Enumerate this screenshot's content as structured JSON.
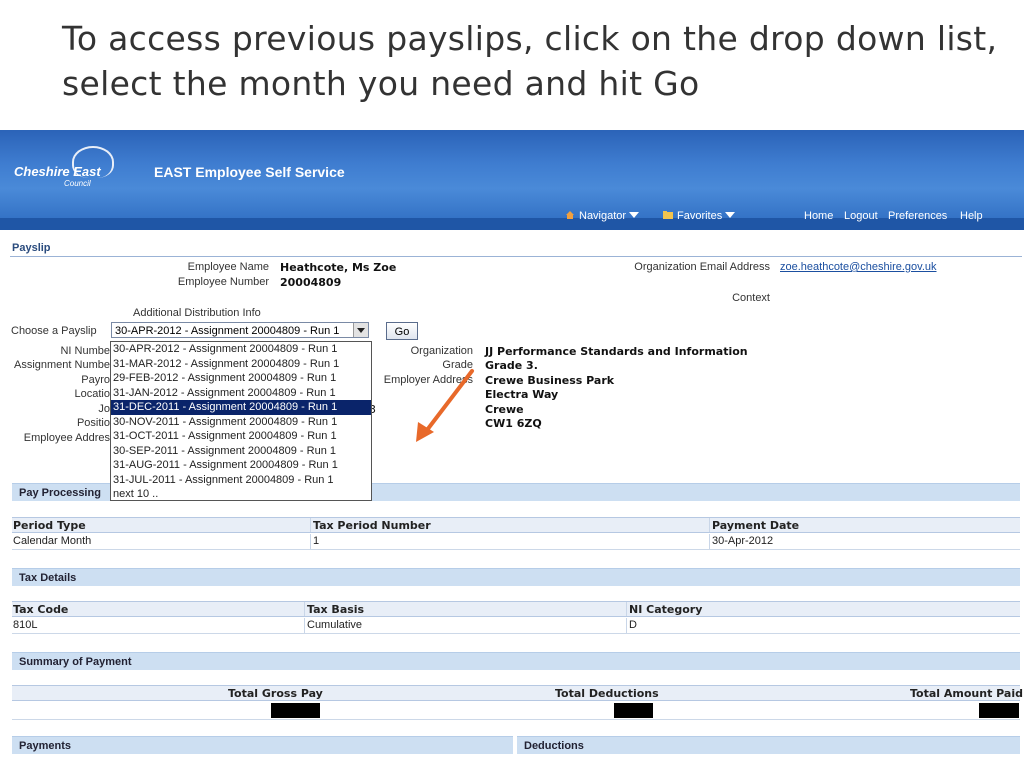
{
  "slide": {
    "title": "To access previous payslips, click on the drop down list, select the month you need and hit Go"
  },
  "header": {
    "logo_text": "Cheshire East",
    "logo_sub": "Council",
    "app_title": "EAST Employee Self Service",
    "navigator": "Navigator",
    "favorites": "Favorites",
    "links": [
      "Home",
      "Logout",
      "Preferences",
      "Help"
    ]
  },
  "payslip": {
    "section_title": "Payslip",
    "employee_name_label": "Employee Name",
    "employee_name": "Heathcote, Ms Zoe",
    "employee_number_label": "Employee Number",
    "employee_number": "20004809",
    "org_email_label": "Organization Email Address",
    "org_email": "zoe.heathcote@cheshire.gov.uk",
    "context_label": "Context",
    "additional_info_label": "Additional Distribution Info",
    "choose_label": "Choose a Payslip",
    "selected_payslip": "30-APR-2012 - Assignment 20004809 - Run 1",
    "go_label": "Go",
    "left_labels": [
      "NI Numbe",
      "Assignment Numbe",
      "Payro",
      "Locatio",
      "Jo",
      "Positio",
      "Employee Addres"
    ],
    "job_suffix": "3",
    "organization_label": "Organization",
    "organization": "JJ Performance Standards and Information",
    "grade_label": "Grade",
    "grade": "Grade 3.",
    "employer_address_label": "Employer Address",
    "employer_address": [
      "Crewe Business Park",
      "Electra Way",
      "Crewe",
      "CW1 6ZQ"
    ]
  },
  "dropdown": {
    "items": [
      "30-APR-2012 - Assignment 20004809 - Run 1",
      "31-MAR-2012 - Assignment 20004809 - Run 1",
      "29-FEB-2012 - Assignment 20004809 - Run 1",
      "31-JAN-2012 - Assignment 20004809 - Run 1",
      "31-DEC-2011 - Assignment 20004809 - Run 1",
      "30-NOV-2011 - Assignment 20004809 - Run 1",
      "31-OCT-2011 - Assignment 20004809 - Run 1",
      "30-SEP-2011 - Assignment 20004809 - Run 1",
      "31-AUG-2011 - Assignment 20004809 - Run 1",
      "31-JUL-2011 - Assignment 20004809 - Run 1",
      "next 10 .."
    ],
    "highlighted": "31-DEC-2011 - Assignment 20004809 - Run 1"
  },
  "pay_processing": {
    "title": "Pay Processing",
    "headers": [
      "Period Type",
      "Tax Period Number",
      "Payment Date"
    ],
    "row": [
      "Calendar Month",
      "1",
      "30-Apr-2012"
    ]
  },
  "tax_details": {
    "title": "Tax Details",
    "headers": [
      "Tax Code",
      "Tax Basis",
      "NI Category"
    ],
    "row": [
      "810L",
      "Cumulative",
      "D"
    ]
  },
  "summary": {
    "title": "Summary of Payment",
    "headers": [
      "Total Gross Pay",
      "Total Deductions",
      "Total Amount Paid"
    ]
  },
  "bottom": {
    "payments": "Payments",
    "deductions": "Deductions"
  },
  "colors": {
    "banner": "#3f7dd0",
    "section_bar": "#cddff2",
    "highlight": "#0a246a",
    "arrow": "#e8692a"
  }
}
